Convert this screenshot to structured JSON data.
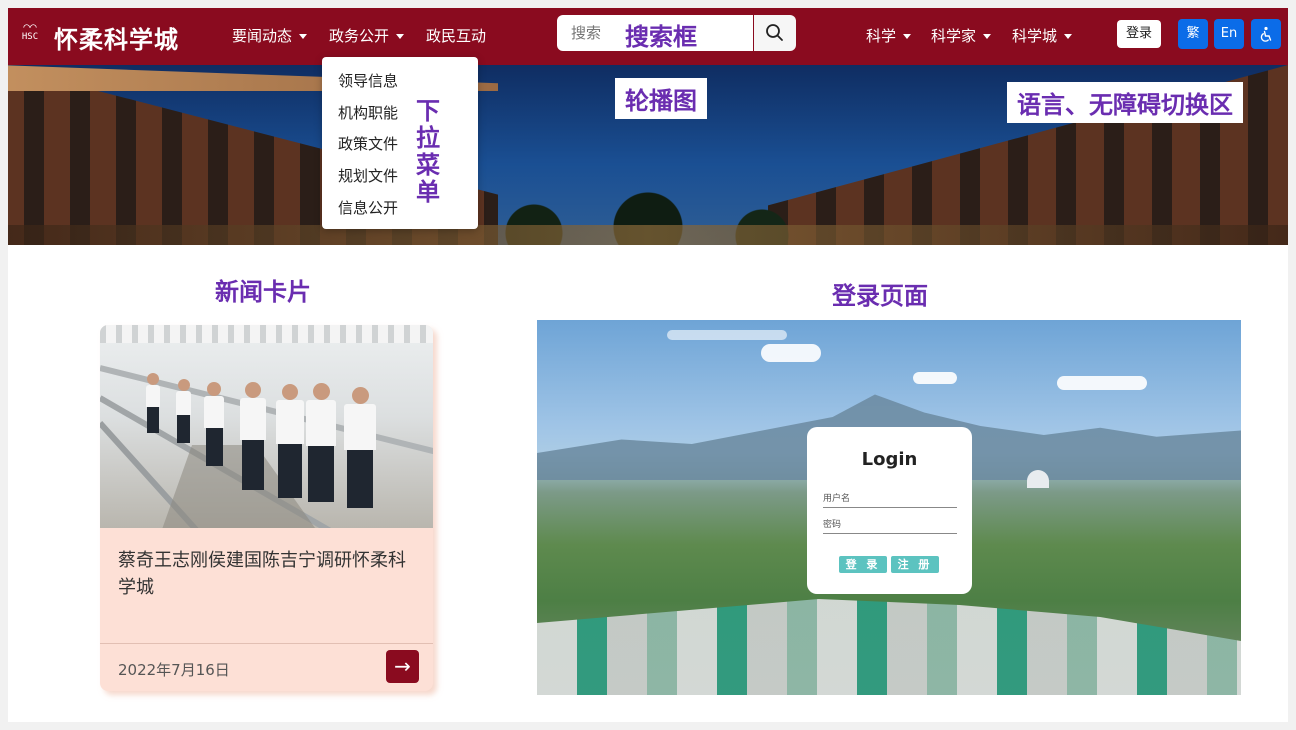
{
  "header": {
    "logo_mark": "HSC",
    "logo_text": "怀柔科学城",
    "nav_left": [
      {
        "label": "要闻动态",
        "has_caret": true
      },
      {
        "label": "政务公开",
        "has_caret": true
      },
      {
        "label": "政民互动",
        "has_caret": false
      }
    ],
    "search": {
      "placeholder": "搜索",
      "annotation": "搜索框"
    },
    "nav_right": [
      {
        "label": "科学",
        "has_caret": true
      },
      {
        "label": "科学家",
        "has_caret": true
      },
      {
        "label": "科学城",
        "has_caret": true
      }
    ],
    "login_label": "登录",
    "lang_buttons": {
      "traditional": "繁",
      "english": "En"
    },
    "colors": {
      "brand": "#8a0b1f",
      "toggle": "#0b6ce8",
      "annotation": "#6a2db0"
    }
  },
  "dropdown": {
    "items": [
      "领导信息",
      "机构职能",
      "政策文件",
      "规划文件",
      "信息公开"
    ],
    "annotation": "下拉菜单"
  },
  "banner": {
    "annotation": "轮播图",
    "lang_annotation": "语言、无障碍切换区"
  },
  "news": {
    "section_title": "新闻卡片",
    "card": {
      "title": "蔡奇王志刚侯建国陈吉宁调研怀柔科学城",
      "date": "2022年7月16日"
    }
  },
  "login": {
    "section_title": "登录页面",
    "form": {
      "heading": "Login",
      "username_label": "用户名",
      "password_label": "密码",
      "login_button": "登 录",
      "register_button": "注 册"
    }
  }
}
